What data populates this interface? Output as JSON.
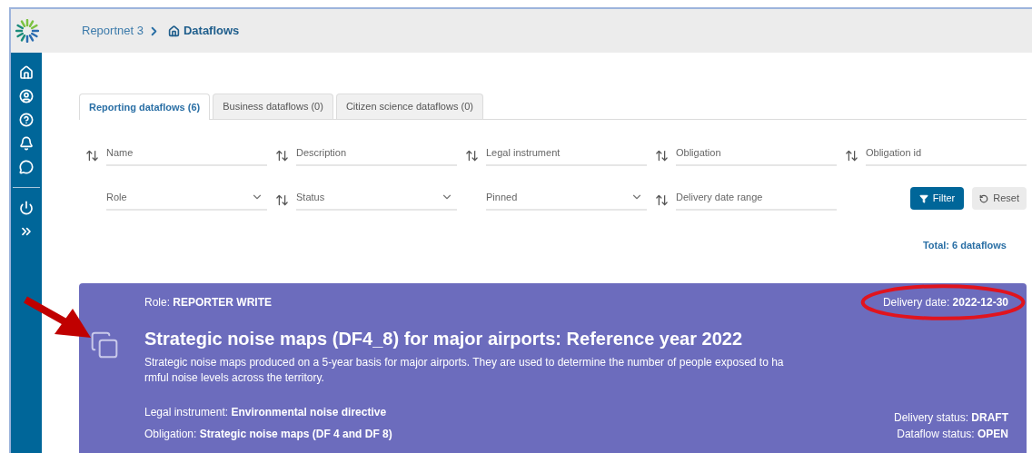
{
  "breadcrumb": {
    "parent": "Reportnet 3",
    "current": "Dataflows"
  },
  "sidebar": {
    "top_items": [
      {
        "kind": "home"
      },
      {
        "kind": "user"
      },
      {
        "kind": "help"
      },
      {
        "kind": "notifications"
      },
      {
        "kind": "feedback"
      }
    ],
    "bottom_items": [
      {
        "kind": "logout"
      },
      {
        "kind": "expand"
      }
    ]
  },
  "tabs": [
    {
      "label": "Reporting dataflows (6)",
      "selected": true
    },
    {
      "label": "Business dataflows (0)",
      "selected": false
    },
    {
      "label": "Citizen science dataflows (0)",
      "selected": false
    }
  ],
  "filters": [
    {
      "placeholder": "Name",
      "kind": "text",
      "sortable": true
    },
    {
      "placeholder": "Description",
      "kind": "text",
      "sortable": true
    },
    {
      "placeholder": "Legal instrument",
      "kind": "text",
      "sortable": true
    },
    {
      "placeholder": "Obligation",
      "kind": "text",
      "sortable": true
    },
    {
      "placeholder": "Obligation id",
      "kind": "text",
      "sortable": true
    },
    {
      "placeholder": "Role",
      "kind": "select",
      "sortable": false
    },
    {
      "placeholder": "Status",
      "kind": "select",
      "sortable": true
    },
    {
      "placeholder": "Pinned",
      "kind": "select",
      "sortable": false
    },
    {
      "placeholder": "Delivery date range",
      "kind": "text",
      "sortable": true
    }
  ],
  "buttons": {
    "filter": "Filter",
    "reset": "Reset"
  },
  "total": "Total: 6 dataflows",
  "card": {
    "role": "Role: **REPORTER WRITE**",
    "delivery_date": "Delivery date: **2022-12-30**",
    "title": "Strategic noise maps (DF4_8) for major airports: Reference year 2022",
    "description": "Strategic noise maps produced on a 5-year basis for major airports. They are used to determine the number of people exposed to ha\nrmful noise levels across the territory.",
    "legal_instrument": "Legal instrument: **Environmental noise directive**",
    "obligation": "Obligation: **Strategic noise maps (DF 4 and DF 8)**",
    "delivery_status": "Delivery status: **DRAFT**",
    "dataflow_status": "Dataflow status: **OPEN**"
  }
}
